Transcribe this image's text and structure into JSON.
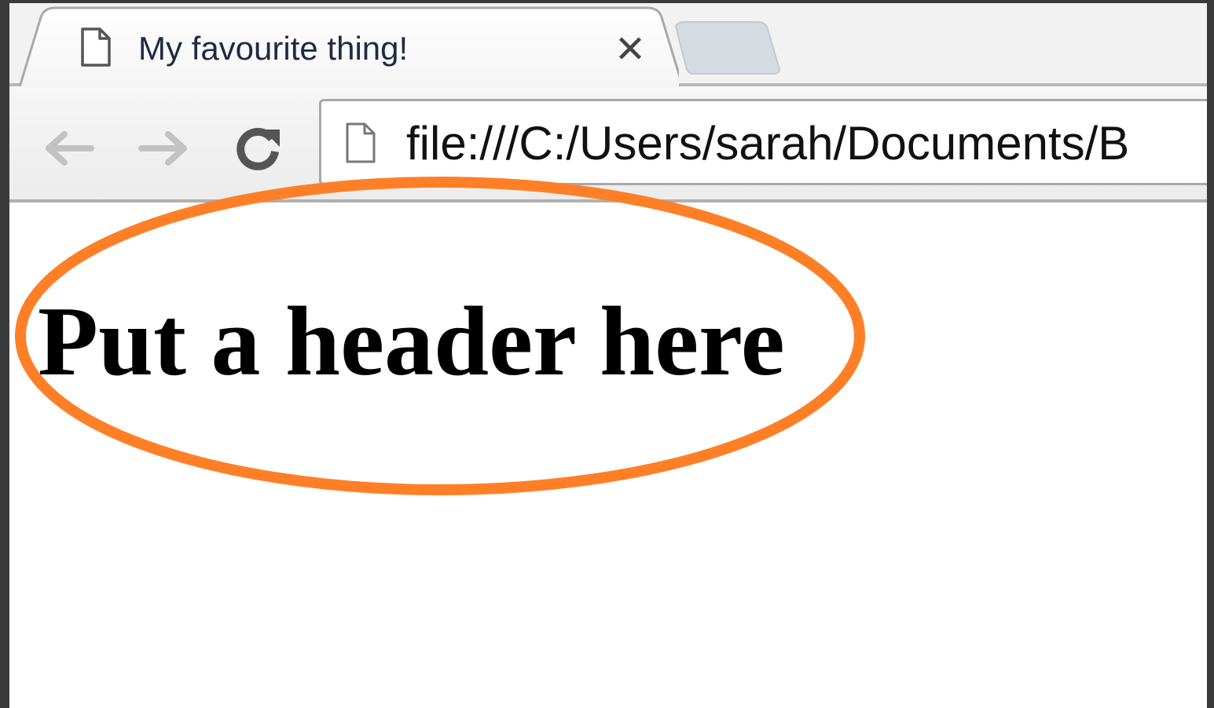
{
  "browser": {
    "tab": {
      "title": "My favourite thing!",
      "icon": "page-icon",
      "close_glyph": "✕"
    },
    "new_tab_icon": "new-tab-icon",
    "nav": {
      "back_icon": "back-arrow-icon",
      "forward_icon": "forward-arrow-icon",
      "reload_icon": "reload-icon"
    },
    "address_bar": {
      "icon": "page-icon",
      "url": "file:///C:/Users/sarah/Documents/B"
    }
  },
  "page": {
    "heading": "Put a header here"
  },
  "annotation": {
    "shape": "ellipse",
    "color": "#ff7f27",
    "target": "page-heading"
  }
}
